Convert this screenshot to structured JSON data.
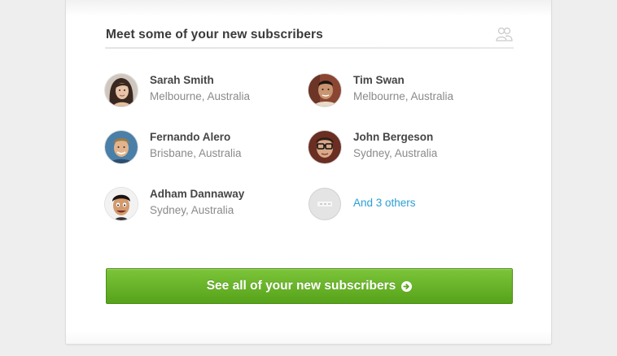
{
  "section": {
    "title": "Meet some of your new subscribers",
    "icon": "people-icon"
  },
  "subscribers": [
    {
      "name": "Sarah Smith",
      "location": "Melbourne, Australia",
      "avatar": "avatar-sarah"
    },
    {
      "name": "Tim Swan",
      "location": "Melbourne, Australia",
      "avatar": "avatar-tim"
    },
    {
      "name": "Fernando Alero",
      "location": "Brisbane, Australia",
      "avatar": "avatar-fernando"
    },
    {
      "name": "John Bergeson",
      "location": "Sydney, Australia",
      "avatar": "avatar-john"
    },
    {
      "name": "Adham Dannaway",
      "location": "Sydney, Australia",
      "avatar": "avatar-adham"
    }
  ],
  "others": {
    "label": "And 3 others"
  },
  "cta": {
    "label": "See all of your new subscribers",
    "icon": "arrow-right-circle-icon"
  },
  "colors": {
    "accent_green": "#6bb52b",
    "link_blue": "#2a9fd6",
    "title_text": "#3a3a3a",
    "secondary_text": "#8a8a8a"
  }
}
